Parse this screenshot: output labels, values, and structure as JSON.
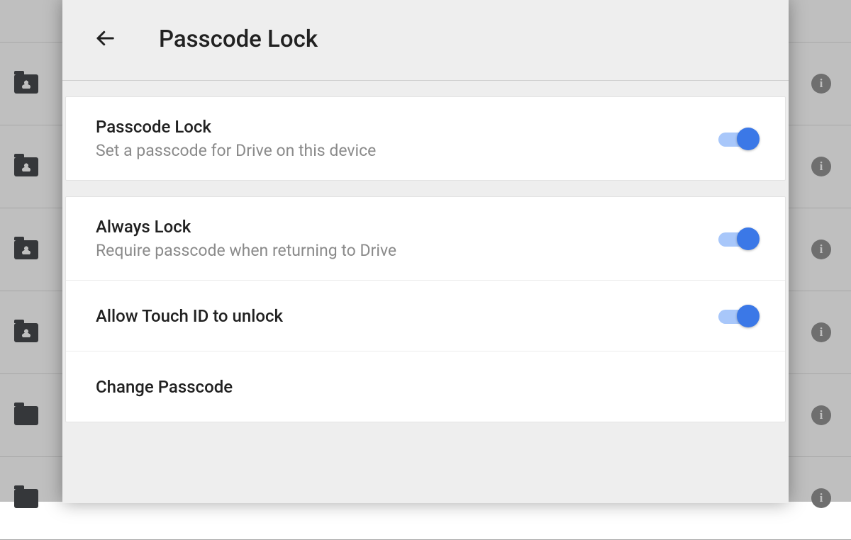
{
  "header": {
    "title": "Passcode Lock"
  },
  "sections": [
    {
      "rows": [
        {
          "title": "Passcode Lock",
          "subtitle": "Set a passcode for Drive on this device",
          "toggle": true
        }
      ]
    },
    {
      "rows": [
        {
          "title": "Always Lock",
          "subtitle": "Require passcode when returning to Drive",
          "toggle": true
        },
        {
          "title": "Allow Touch ID to unlock",
          "toggle": true
        },
        {
          "title": "Change Passcode"
        }
      ]
    }
  ]
}
